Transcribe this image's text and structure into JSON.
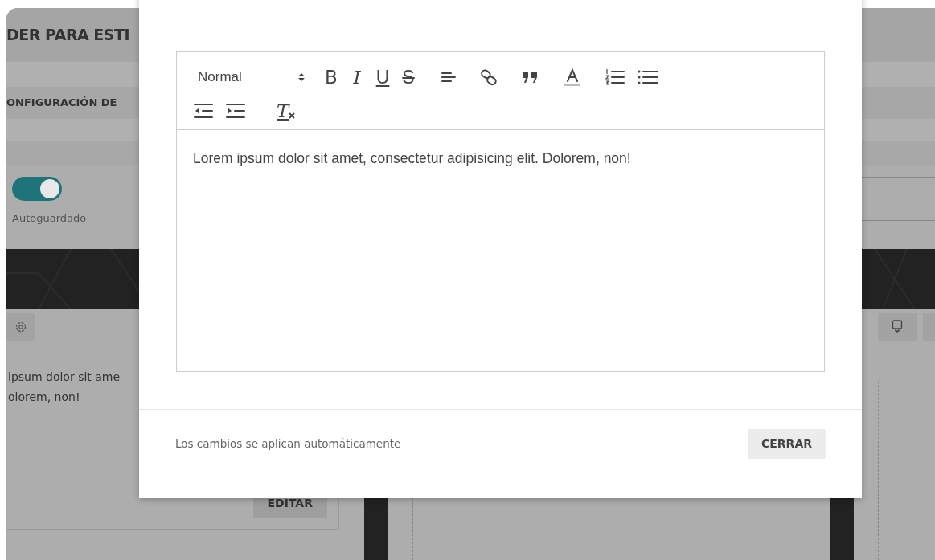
{
  "page": {
    "title": "DER PARA ESTI",
    "section": "ONFIGURACIÓN DE",
    "autosave": {
      "label": "Autoguardado",
      "on": true
    },
    "card": {
      "lines": [
        "ipsum dolor sit ame",
        "olorem, non!"
      ],
      "button": "EDITAR"
    }
  },
  "modal": {
    "toolbar": [
      {
        "kind": "header",
        "label": "Normal"
      },
      {
        "kind": "bold",
        "label": "B"
      },
      {
        "kind": "italic",
        "label": "I"
      },
      {
        "kind": "underline",
        "label": "U"
      },
      {
        "kind": "strike",
        "label": "S"
      },
      {
        "kind": "align"
      },
      {
        "kind": "link"
      },
      {
        "kind": "quote"
      },
      {
        "kind": "color"
      },
      {
        "kind": "ordered"
      },
      {
        "kind": "bullet"
      },
      {
        "kind": "outdent"
      },
      {
        "kind": "indent"
      },
      {
        "kind": "clean",
        "label": "T"
      }
    ],
    "content": "Lorem ipsum dolor sit amet, consectetur adipisicing elit. Dolorem, non!",
    "footer_note": "Los cambios se aplican automáticamente",
    "close_button": "CERRAR"
  }
}
